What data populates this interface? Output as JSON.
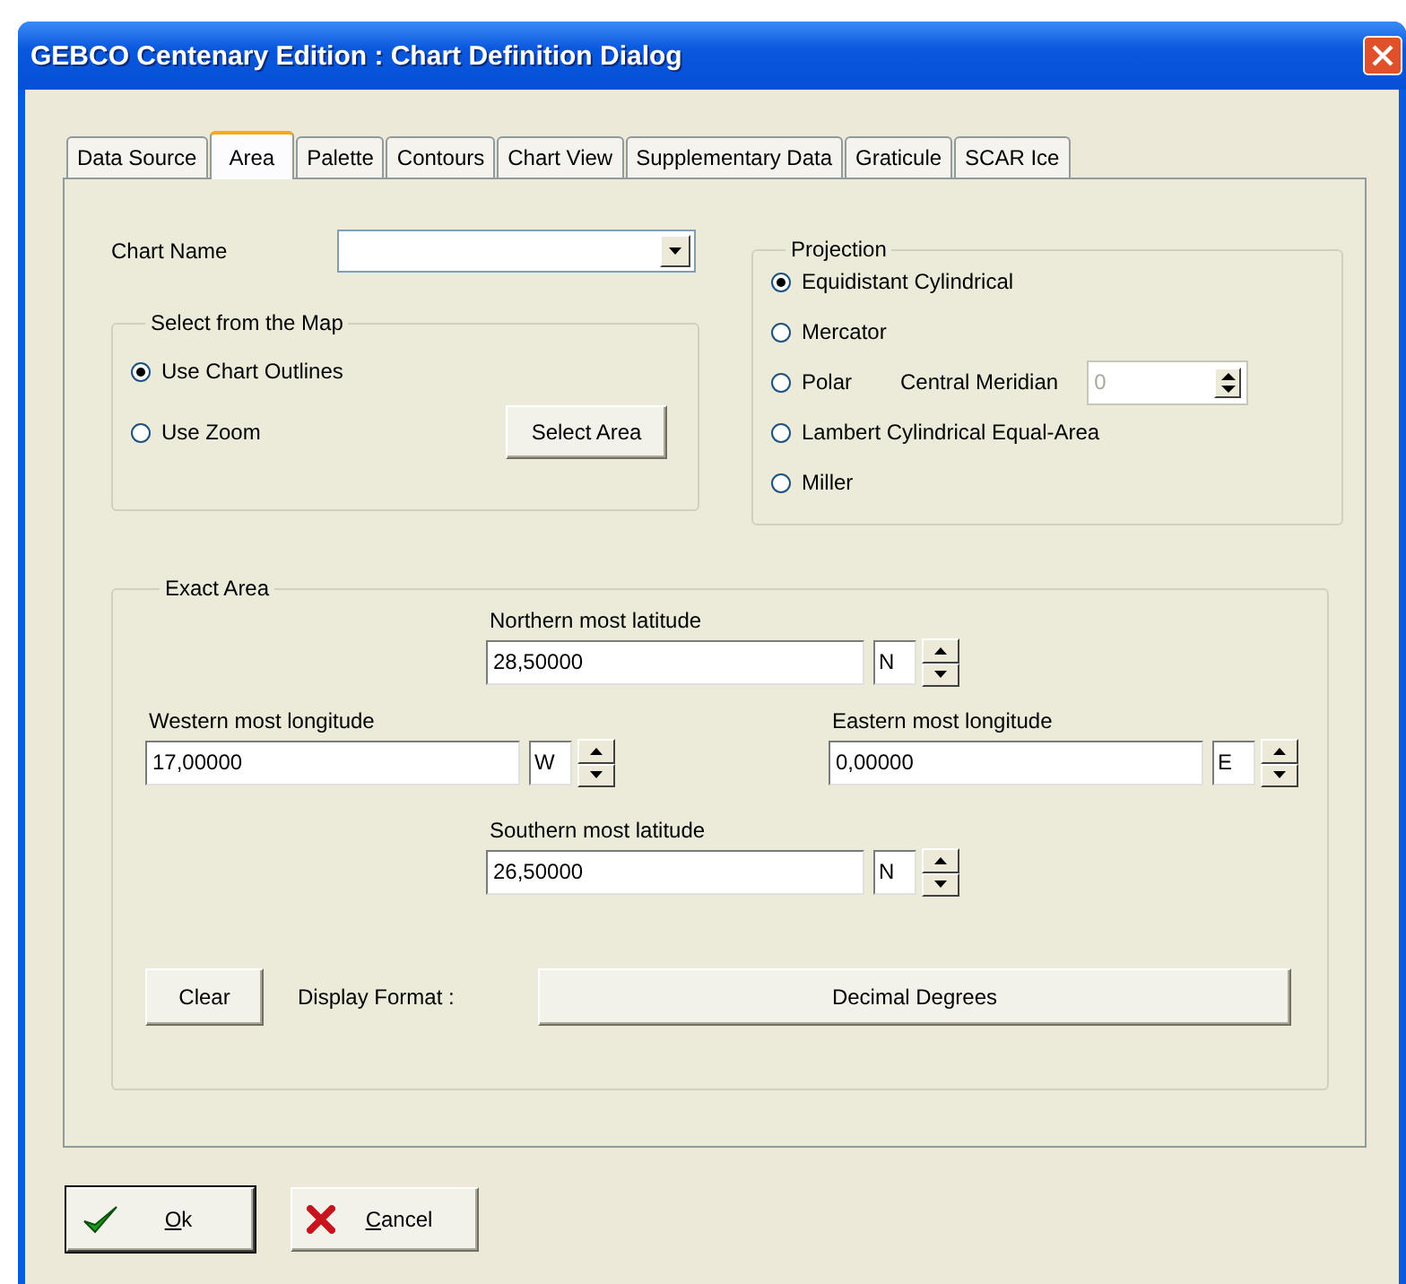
{
  "window": {
    "title": "GEBCO Centenary Edition : Chart Definition Dialog"
  },
  "tabs": [
    {
      "label": "Data Source",
      "selected": false
    },
    {
      "label": "Area",
      "selected": true
    },
    {
      "label": "Palette",
      "selected": false
    },
    {
      "label": "Contours",
      "selected": false
    },
    {
      "label": "Chart View",
      "selected": false
    },
    {
      "label": "Supplementary Data",
      "selected": false
    },
    {
      "label": "Graticule",
      "selected": false
    },
    {
      "label": "SCAR Ice",
      "selected": false
    }
  ],
  "chart_name": {
    "label": "Chart Name"
  },
  "select_from_map": {
    "title": "Select from the Map",
    "options": [
      {
        "label": "Use Chart Outlines",
        "selected": true
      },
      {
        "label": "Use Zoom",
        "selected": false
      }
    ],
    "button": "Select Area"
  },
  "projection": {
    "title": "Projection",
    "options": [
      {
        "label": "Equidistant Cylindrical",
        "selected": true
      },
      {
        "label": "Mercator",
        "selected": false
      },
      {
        "label": "Polar",
        "selected": false,
        "central_meridian": {
          "label": "Central Meridian",
          "value": "0",
          "disabled": true
        }
      },
      {
        "label": "Lambert Cylindrical Equal-Area",
        "selected": false
      },
      {
        "label": "Miller",
        "selected": false
      }
    ]
  },
  "exact_area": {
    "title": "Exact Area",
    "bounds": [
      {
        "kind": "north",
        "label": "Northern most latitude",
        "value": "28,50000",
        "hemisphere": "N"
      },
      {
        "kind": "west",
        "label": "Western most longitude",
        "value": "17,00000",
        "hemisphere": "W"
      },
      {
        "kind": "east",
        "label": "Eastern most longitude",
        "value": "0,00000",
        "hemisphere": "E"
      },
      {
        "kind": "south",
        "label": "Southern most latitude",
        "value": "26,50000",
        "hemisphere": "N"
      }
    ],
    "clear_button": "Clear",
    "display_format": {
      "label": "Display Format :",
      "value": "Decimal Degrees"
    }
  },
  "buttons": [
    {
      "kind": "ok",
      "label": "Ok",
      "underline_first": true
    },
    {
      "kind": "cancel",
      "label": "Cancel",
      "underline_first": true
    }
  ]
}
